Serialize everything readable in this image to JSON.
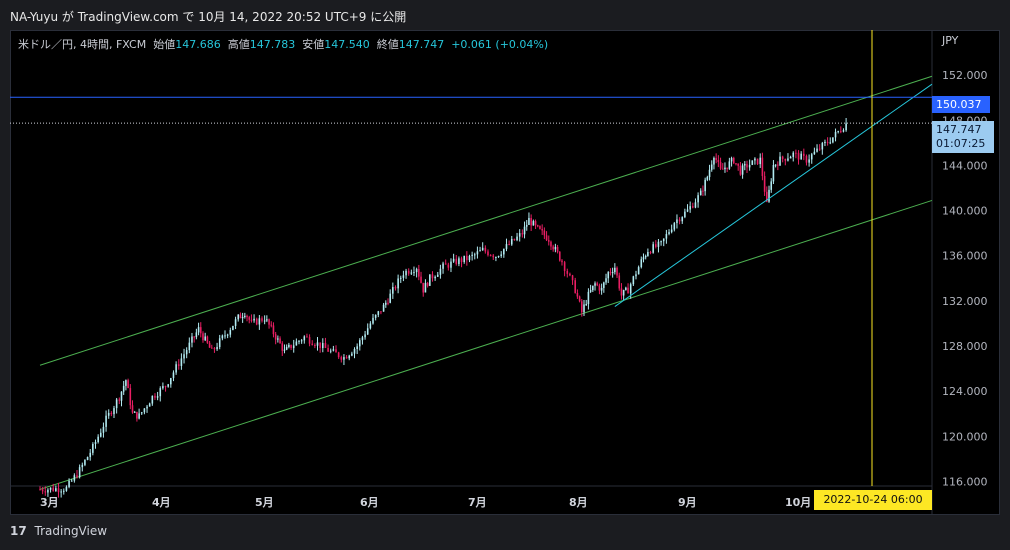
{
  "header": {
    "title": "NA-Yuyu が TradingView.com で 10月 14, 2022 20:52 UTC+9 に公開"
  },
  "legend": {
    "symbol": "米ドル／円, 4時間, FXCM",
    "open_label": "始値",
    "open": "147.686",
    "high_label": "高値",
    "high": "147.783",
    "low_label": "安値",
    "low": "147.540",
    "close_label": "終値",
    "close": "147.747",
    "change": "+0.061 (+0.04%)"
  },
  "axis": {
    "currency": "JPY",
    "hline_value": "150.037",
    "last_price": "147.747",
    "countdown": "01:07:25",
    "crosshair_date": "2022-10-24  06:00"
  },
  "footer": {
    "brand": "TradingView"
  },
  "colors": {
    "background": "#000000",
    "candle_up": "#b2ebf2",
    "candle_down": "#e91e63",
    "channel": "#4caf50",
    "trendline": "#26c6da",
    "hline": "#2962ff",
    "crosshair": "#fde724"
  },
  "chart_data": {
    "type": "candlestick",
    "symbol": "米ドル／円, 4時間, FXCM",
    "x_ticks": [
      "3月",
      "4月",
      "5月",
      "6月",
      "7月",
      "8月",
      "9月",
      "10月"
    ],
    "y_ticks": [
      "152.000",
      "148.000",
      "144.000",
      "140.000",
      "136.000",
      "132.000",
      "128.000",
      "124.000",
      "120.000",
      "116.000"
    ],
    "ylim": [
      115.6,
      156.0
    ],
    "price_path": [
      [
        0,
        115.3
      ],
      [
        4,
        115.4
      ],
      [
        6,
        117.0
      ],
      [
        8,
        119.0
      ],
      [
        10,
        121.5
      ],
      [
        12,
        123.5
      ],
      [
        13,
        125.0
      ],
      [
        14,
        122.0
      ],
      [
        15,
        121.8
      ],
      [
        17,
        123.5
      ],
      [
        19,
        124.5
      ],
      [
        21,
        126.5
      ],
      [
        23,
        128.5
      ],
      [
        24,
        129.5
      ],
      [
        25,
        128.5
      ],
      [
        26,
        127.5
      ],
      [
        28,
        129.0
      ],
      [
        30,
        130.5
      ],
      [
        31,
        131.0
      ],
      [
        32,
        130.0
      ],
      [
        34,
        130.5
      ],
      [
        35,
        129.5
      ],
      [
        36,
        128.5
      ],
      [
        37,
        127.5
      ],
      [
        38,
        128.0
      ],
      [
        40,
        128.8
      ],
      [
        42,
        128.2
      ],
      [
        44,
        127.5
      ],
      [
        46,
        127.0
      ],
      [
        48,
        128.0
      ],
      [
        50,
        130.0
      ],
      [
        52,
        131.5
      ],
      [
        53,
        132.5
      ],
      [
        55,
        134.5
      ],
      [
        57,
        135.0
      ],
      [
        58,
        133.0
      ],
      [
        59,
        134.0
      ],
      [
        61,
        135.0
      ],
      [
        63,
        135.5
      ],
      [
        65,
        135.8
      ],
      [
        67,
        136.5
      ],
      [
        69,
        136.0
      ],
      [
        71,
        137.0
      ],
      [
        73,
        138.0
      ],
      [
        74,
        139.2
      ],
      [
        75,
        138.5
      ],
      [
        76,
        138.0
      ],
      [
        77,
        137.5
      ],
      [
        78,
        136.5
      ],
      [
        79,
        135.5
      ],
      [
        81,
        133.0
      ],
      [
        82,
        131.0
      ],
      [
        83,
        132.5
      ],
      [
        84,
        133.5
      ],
      [
        85,
        133.0
      ],
      [
        86,
        134.5
      ],
      [
        87,
        135.0
      ],
      [
        88,
        132.5
      ],
      [
        89,
        133.0
      ],
      [
        91,
        135.5
      ],
      [
        92,
        136.5
      ],
      [
        94,
        137.0
      ],
      [
        96,
        139.0
      ],
      [
        98,
        140.0
      ],
      [
        100,
        141.5
      ],
      [
        101,
        143.0
      ],
      [
        102,
        145.0
      ],
      [
        103,
        143.5
      ],
      [
        104,
        144.0
      ],
      [
        105,
        144.5
      ],
      [
        106,
        143.5
      ],
      [
        107,
        144.0
      ],
      [
        109,
        144.5
      ],
      [
        110,
        140.5
      ],
      [
        111,
        144.0
      ],
      [
        112,
        144.5
      ],
      [
        114,
        145.0
      ],
      [
        116,
        144.5
      ],
      [
        118,
        145.5
      ],
      [
        120,
        146.5
      ],
      [
        122,
        147.7
      ]
    ],
    "horizontal_line": 150.037,
    "last_price": 147.747,
    "crosshair_date": "2022-10-24 06:00",
    "channel_upper": [
      [
        0,
        126.3
      ],
      [
        135,
        151.9
      ]
    ],
    "channel_lower": [
      [
        0,
        115.3
      ],
      [
        135,
        140.9
      ]
    ],
    "trendline": [
      [
        87,
        131.5
      ],
      [
        135,
        151.2
      ]
    ]
  }
}
